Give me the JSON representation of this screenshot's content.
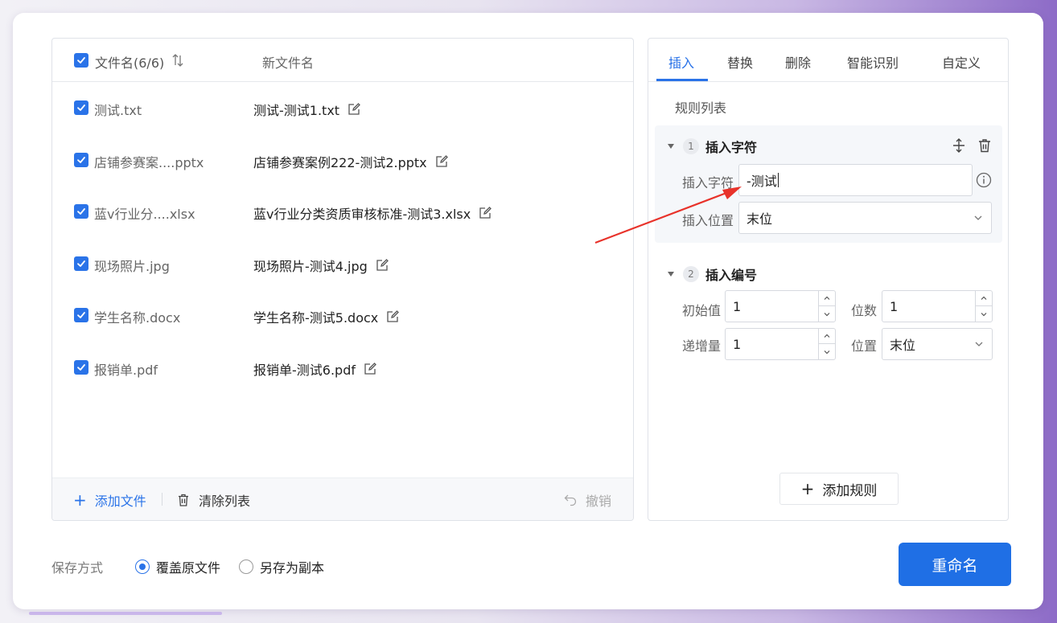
{
  "file_list": {
    "header": {
      "name_label": "文件名(6/6)",
      "new_name_label": "新文件名"
    },
    "rows": [
      {
        "original": "测试.txt",
        "new_name": "测试-测试1.txt"
      },
      {
        "original": "店铺参赛案....pptx",
        "new_name": "店铺参赛案例222-测试2.pptx"
      },
      {
        "original": "蓝v行业分....xlsx",
        "new_name": "蓝v行业分类资质审核标准-测试3.xlsx"
      },
      {
        "original": "现场照片.jpg",
        "new_name": "现场照片-测试4.jpg"
      },
      {
        "original": "学生名称.docx",
        "new_name": "学生名称-测试5.docx"
      },
      {
        "original": "报销单.pdf",
        "new_name": "报销单-测试6.pdf"
      }
    ],
    "footer": {
      "add_file": "添加文件",
      "clear_list": "清除列表",
      "undo": "撤销"
    }
  },
  "tabs": [
    "插入",
    "替换",
    "删除",
    "智能识别",
    "自定义"
  ],
  "active_tab": "插入",
  "rules": {
    "title": "规则列表",
    "rule1": {
      "index": "1",
      "title": "插入字符",
      "char_label": "插入字符",
      "char_value": "-测试",
      "pos_label": "插入位置",
      "pos_value": "末位"
    },
    "rule2": {
      "index": "2",
      "title": "插入编号",
      "start_label": "初始值",
      "start_value": "1",
      "digits_label": "位数",
      "digits_value": "1",
      "step_label": "递增量",
      "step_value": "1",
      "position_label": "位置",
      "position_value": "末位"
    },
    "add_rule": "添加规则"
  },
  "save": {
    "label": "保存方式",
    "option_overwrite": "覆盖原文件",
    "option_copy": "另存为副本",
    "selected": "覆盖原文件"
  },
  "rename_button": "重命名",
  "colors": {
    "accent": "#2a73e8",
    "annotation_arrow": "#e8322a"
  }
}
